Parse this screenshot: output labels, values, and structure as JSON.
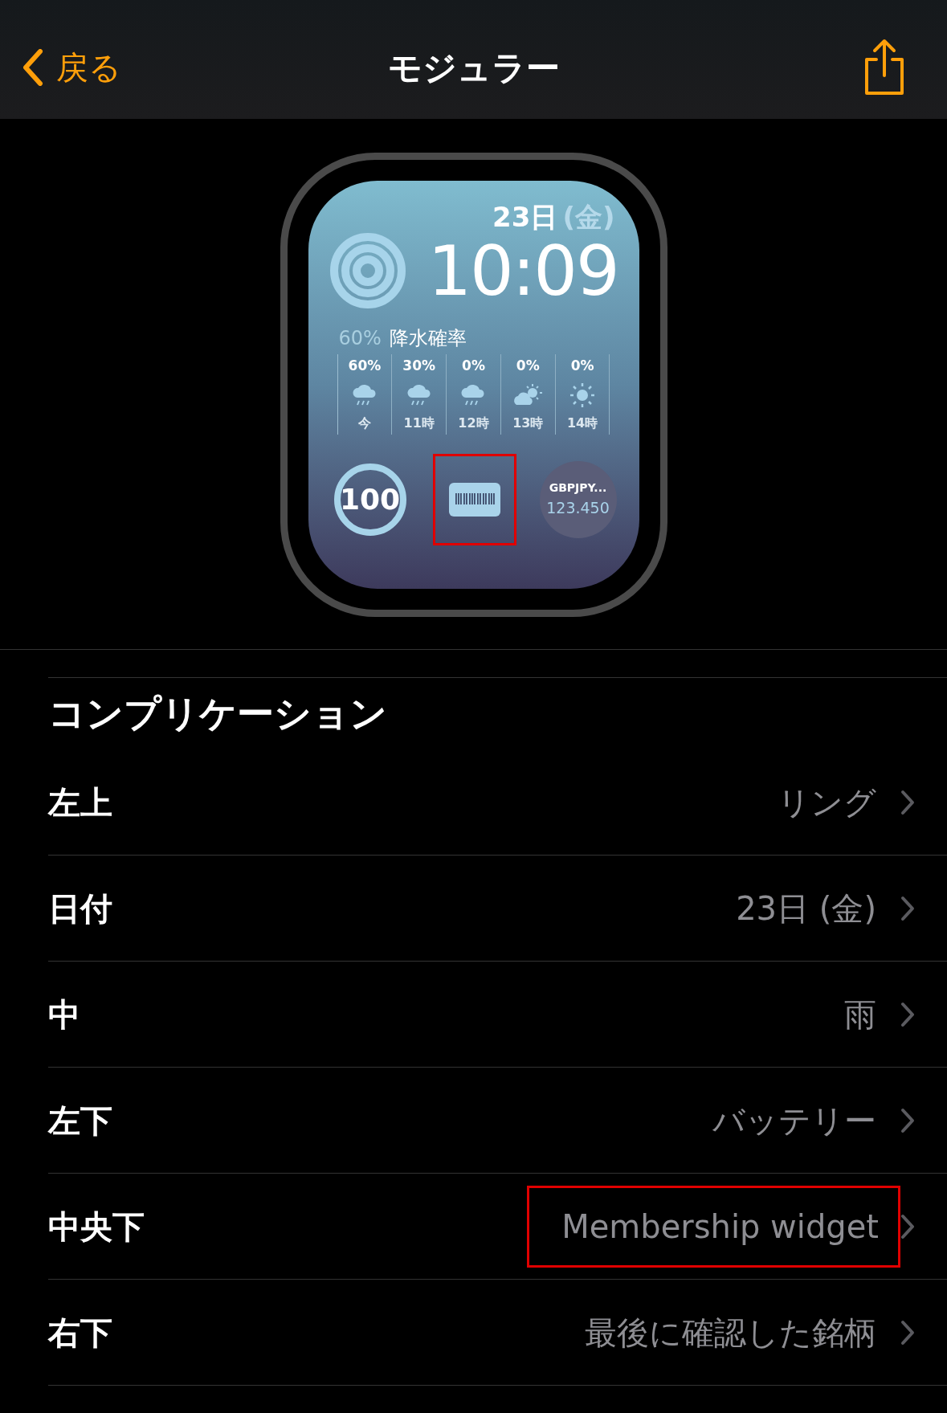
{
  "nav": {
    "back": "戻る",
    "title": "モジュラー"
  },
  "watch": {
    "date": "23日",
    "weekday": "(金)",
    "time": "10:09",
    "precip": {
      "value": "60%",
      "label": "降水確率"
    },
    "forecast": [
      {
        "percent": "60%",
        "kind": "rain",
        "hour": "今"
      },
      {
        "percent": "30%",
        "kind": "rain",
        "hour": "11時"
      },
      {
        "percent": "0%",
        "kind": "rain",
        "hour": "12時"
      },
      {
        "percent": "0%",
        "kind": "partly-sunny",
        "hour": "13時"
      },
      {
        "percent": "0%",
        "kind": "sunny",
        "hour": "14時"
      }
    ],
    "battery": {
      "value": "100"
    },
    "center": {
      "kind": "barcode",
      "highlighted": true
    },
    "stock": {
      "symbol": "GBPJPY...",
      "price": "123.450"
    }
  },
  "section": {
    "title": "コンプリケーション",
    "rows": [
      {
        "label": "左上",
        "value": "リング",
        "highlighted": false
      },
      {
        "label": "日付",
        "value": "23日 (金)",
        "highlighted": false
      },
      {
        "label": "中",
        "value": "雨",
        "highlighted": false
      },
      {
        "label": "左下",
        "value": "バッテリー",
        "highlighted": false
      },
      {
        "label": "中央下",
        "value": "Membership widget",
        "highlighted": true
      },
      {
        "label": "右下",
        "value": "最後に確認した銘柄",
        "highlighted": false
      }
    ]
  }
}
